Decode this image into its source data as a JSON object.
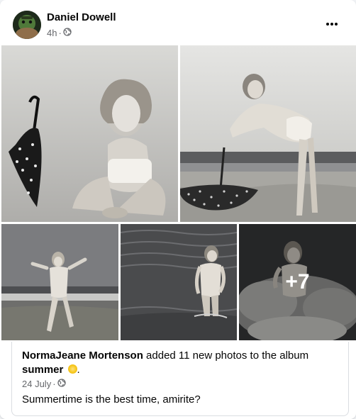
{
  "post": {
    "author": "Daniel Dowell",
    "time": "4h",
    "separator": "·",
    "privacy_icon": "globe-icon",
    "more_icon": "more-options-icon"
  },
  "photos": {
    "items": [
      {
        "name": "photo-sitting-with-umbrella"
      },
      {
        "name": "photo-leaning-on-umbrella"
      },
      {
        "name": "photo-arms-outstretched-shore"
      },
      {
        "name": "photo-standing-in-water"
      },
      {
        "name": "photo-in-waves"
      }
    ],
    "more_count": "+7"
  },
  "attachment": {
    "actor": "NormaJeane Mortenson",
    "action": " added 11 new photos to the album ",
    "album": "summer",
    "emoji": "sun-emoji",
    "end": ".",
    "date": "24 July",
    "separator": "·",
    "privacy_icon": "globe-icon",
    "caption": "Summertime is the best time, amirite?"
  },
  "colors": {
    "primary_text": "#050505",
    "secondary_text": "#65676b",
    "card_bg": "#ffffff",
    "page_bg": "#f0f2f5"
  }
}
